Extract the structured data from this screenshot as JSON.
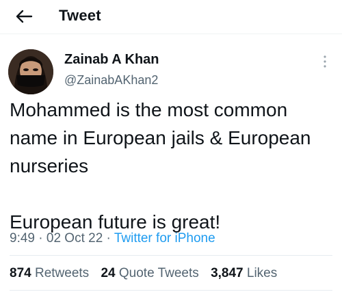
{
  "header": {
    "title": "Tweet"
  },
  "author": {
    "name": "Zainab A Khan",
    "handle": "@ZainabAKhan2"
  },
  "tweet": {
    "text": "Mohammed is the most common name in European jails & European nurseries\n\nEuropean future is great!",
    "time": "9:49",
    "date": "02 Oct 22",
    "source": "Twitter for iPhone",
    "separator": "·"
  },
  "stats": {
    "retweets_count": "874",
    "retweets_label": "Retweets",
    "quotes_count": "24",
    "quotes_label": "Quote Tweets",
    "likes_count": "3,847",
    "likes_label": "Likes"
  },
  "colors": {
    "link": "#1d9bf0",
    "secondary_text": "#536471",
    "primary_text": "#0f1419",
    "divider": "#e6ecf0"
  },
  "icons": {
    "back": "back-arrow-icon",
    "more": "more-vertical-icon"
  }
}
